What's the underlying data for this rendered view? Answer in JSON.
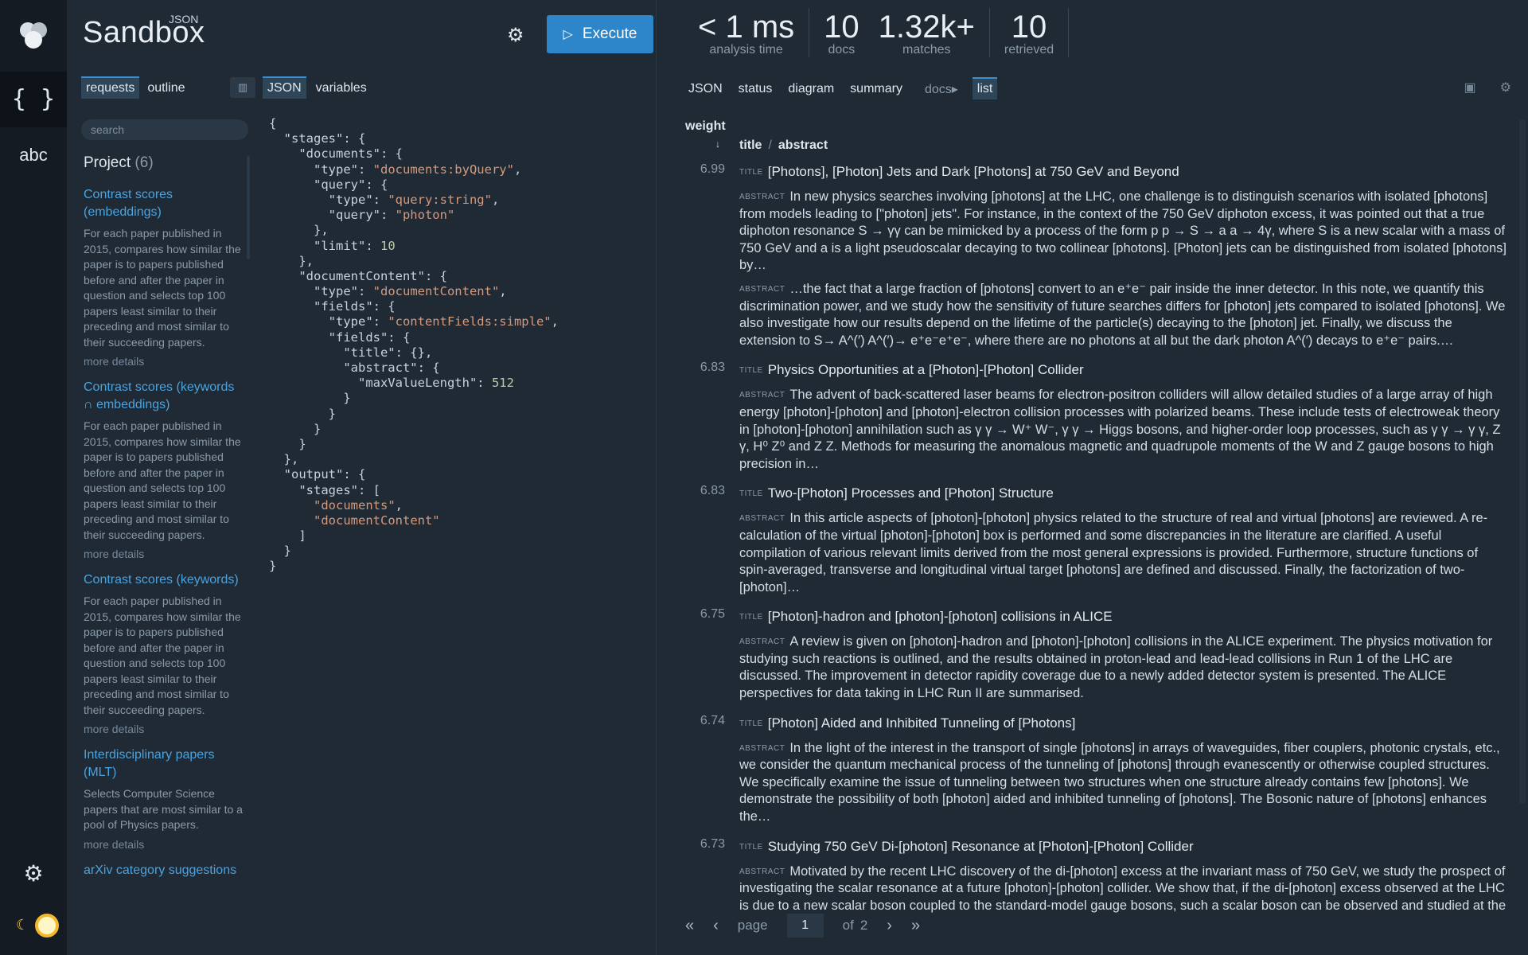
{
  "rail": {
    "json_icon": "{ }",
    "abc_label": "abc",
    "gear_icon": "⚙",
    "moon_icon": "☾"
  },
  "app": {
    "brand_sup": "JSON",
    "brand_name": "Sandbox",
    "settings_icon": "⚙",
    "execute_label": "Execute",
    "execute_icon": "▷"
  },
  "left_tabs": [
    "requests",
    "outline"
  ],
  "editor_tabs": [
    "JSON",
    "variables"
  ],
  "search_placeholder": "search",
  "project": {
    "label": "Project",
    "count": "(6)",
    "items": [
      {
        "title": "Contrast scores (embeddings)",
        "desc": "For each paper published in 2015, compares how similar the paper is to papers published before and after the paper in question and selects top 100 papers least similar to their preceding and most similar to their succeeding papers.",
        "more": "more details"
      },
      {
        "title": "Contrast scores (keywords ∩ embeddings)",
        "desc": "For each paper published in 2015, compares how similar the paper is to papers published before and after the paper in question and selects top 100 papers least similar to their preceding and most similar to their succeeding papers.",
        "more": "more details"
      },
      {
        "title": "Contrast scores (keywords)",
        "desc": "For each paper published in 2015, compares how similar the paper is to papers published before and after the paper in question and selects top 100 papers least similar to their preceding and most similar to their succeeding papers.",
        "more": "more details"
      },
      {
        "title": "Interdisciplinary papers (MLT)",
        "desc": "Selects Computer Science papers that are most similar to a pool of Physics papers.",
        "more": "more details"
      },
      {
        "title": "arXiv category suggestions",
        "desc": "",
        "more": ""
      }
    ]
  },
  "editor": {
    "lines": [
      "{",
      "  \"stages\": {",
      "    \"documents\": {",
      "      \"type\": \"documents:byQuery\",",
      "      \"query\": {",
      "        \"type\": \"query:string\",",
      "        \"query\": \"photon\"",
      "      },",
      "      \"limit\": 10",
      "    },",
      "    \"documentContent\": {",
      "      \"type\": \"documentContent\",",
      "      \"fields\": {",
      "        \"type\": \"contentFields:simple\",",
      "        \"fields\": {",
      "          \"title\": {},",
      "          \"abstract\": {",
      "            \"maxValueLength\": 512",
      "          }",
      "        }",
      "      }",
      "    }",
      "  },",
      "  \"output\": {",
      "    \"stages\": [",
      "      \"documents\",",
      "      \"documentContent\"",
      "    ]",
      "  }",
      "}"
    ]
  },
  "stats": [
    {
      "value": "< 1 ms",
      "label": "analysis time"
    },
    {
      "value": "10",
      "label": "docs"
    },
    {
      "value": "1.32k+",
      "label": "matches"
    },
    {
      "value": "10",
      "label": "retrieved"
    }
  ],
  "result_tabs": [
    "JSON",
    "status",
    "diagram",
    "summary"
  ],
  "result_crumb": "docs",
  "result_crumb_active": "list",
  "columns": {
    "weight": "weight",
    "sort_arrow": "↓",
    "title": "title",
    "sep": "/",
    "abstract": "abstract"
  },
  "labels": {
    "title": "TITLE",
    "abstract": "ABSTRACT"
  },
  "results": [
    {
      "score": "6.99",
      "title": "[Photons], [Photon] Jets and Dark [Photons] at 750 GeV and Beyond",
      "abstracts": [
        "In new physics searches involving [photons] at the LHC, one challenge is to distinguish scenarios with isolated [photons] from models leading to [\"photon] jets\". For instance, in the context of the 750 GeV diphoton excess, it was pointed out that a true diphoton resonance S → γγ can be mimicked by a process of the form p p → S → a a → 4γ, where S is a new scalar with a mass of 750 GeV and a is a light pseudoscalar decaying to two collinear [photons]. [Photon] jets can be distinguished from isolated [photons] by…",
        "…the fact that a large fraction of [photons] convert to an e⁺e⁻ pair inside the inner detector. In this note, we quantify this discrimination power, and we study how the sensitivity of future searches differs for [photon] jets compared to isolated [photons]. We also investigate how our results depend on the lifetime of the particle(s) decaying to the [photon] jet. Finally, we discuss the extension to S→ A^(′) A^(′)→ e⁺e⁻e⁺e⁻, where there are no photons at all but the dark photon A^(′) decays to e⁺e⁻ pairs.…"
      ]
    },
    {
      "score": "6.83",
      "title": "Physics Opportunities at a [Photon]-[Photon] Collider",
      "abstracts": [
        "The advent of back-scattered laser beams for electron-positron colliders will allow detailed studies of a large array of high energy [photon]-[photon] and [photon]-electron collision processes with polarized beams. These include tests of electroweak theory in [photon]-[photon] annihilation such as γ γ → W⁺ W⁻, γ γ → Higgs bosons, and higher-order loop processes, such as γ γ → γ γ, Z γ, H⁰ Z⁰ and Z Z. Methods for measuring the anomalous magnetic and quadrupole moments of the W and Z gauge bosons to high precision in…"
      ]
    },
    {
      "score": "6.83",
      "title": "Two-[Photon] Processes and [Photon] Structure",
      "abstracts": [
        "In this article aspects of [photon]-[photon] physics related to the structure of real and virtual [photons] are reviewed. A re-calculation of the virtual [photon]-[photon] box is performed and some discrepancies in the literature are clarified. A useful compilation of various relevant limits derived from the most general expressions is provided. Furthermore, structure functions of spin-averaged, transverse and longitudinal virtual target [photons] are defined and discussed. Finally, the factorization of two-[photon]…"
      ]
    },
    {
      "score": "6.75",
      "title": "[Photon]-hadron and [photon]-[photon] collisions in ALICE",
      "abstracts": [
        "A review is given on [photon]-hadron and [photon]-[photon] collisions in the ALICE experiment. The physics motivation for studying such reactions is outlined, and the results obtained in proton-lead and lead-lead collisions in Run 1 of the LHC are discussed. The improvement in detector rapidity coverage due to a newly added detector system is presented. The ALICE perspectives for data taking in LHC Run II are summarised."
      ]
    },
    {
      "score": "6.74",
      "title": "[Photon] Aided and Inhibited Tunneling of [Photons]",
      "abstracts": [
        "In the light of the interest in the transport of single [photons] in arrays of waveguides, fiber couplers, photonic crystals, etc., we consider the quantum mechanical process of the tunneling of [photons] through evanescently or otherwise coupled structures. We specifically examine the issue of tunneling between two structures when one structure already contains few [photons]. We demonstrate the possibility of both [photon] aided and inhibited tunneling of [photons]. The Bosonic nature of [photons] enhances the…"
      ]
    },
    {
      "score": "6.73",
      "title": "Studying 750 GeV Di-[photon] Resonance at [Photon]-[Photon] Collider",
      "abstracts": [
        "Motivated by the recent LHC discovery of the di-[photon] excess at the invariant mass of 750 GeV, we study the prospect of investigating the scalar resonance at a future [photon]-[photon] collider. We show that, if the di-[photon] excess observed at the LHC is due to a new scalar boson coupled to the standard-model gauge bosons, such a scalar boson can be observed and studied at the [photon]-[photon] collider with the center-of-mass energy of 1 TeV in large fraction of parameter space."
      ]
    }
  ],
  "pager": {
    "first": "«",
    "prev": "‹",
    "label": "page",
    "current": "1",
    "of": "of",
    "total": "2",
    "next": "›",
    "last": "»"
  },
  "colors": {
    "accent": "#2d86c9",
    "link": "#4aa3df",
    "bg": "#1f2a35"
  }
}
